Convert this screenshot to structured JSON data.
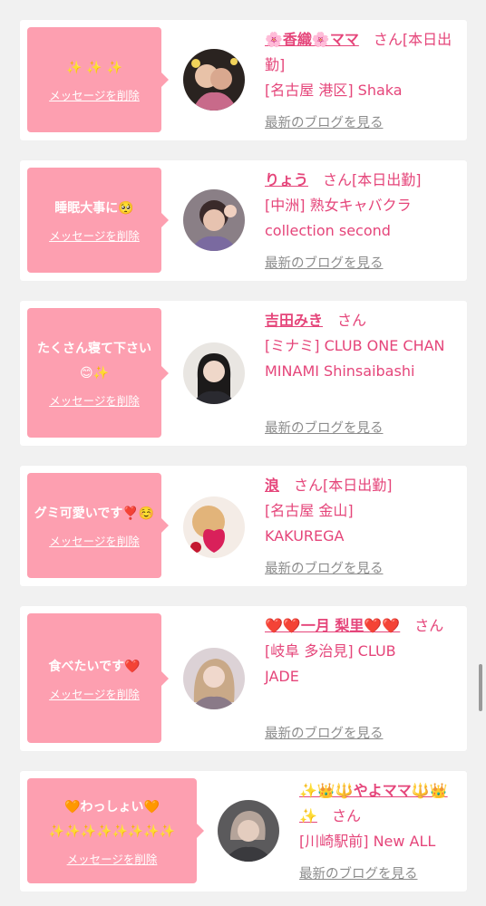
{
  "common": {
    "delete_label": "メッセージを削除",
    "blog_label": "最新のブログを見る",
    "honorific": "さん"
  },
  "colors": {
    "bubble": "#fd9fb0",
    "name": "#e5457a",
    "link_gray": "#8c8c8c"
  },
  "cards": [
    {
      "message": "✨ ✨ ✨",
      "name": "🌸香織🌸ママ",
      "status": "[本日出勤]",
      "shop": "[名古屋 港区] Shaka"
    },
    {
      "message": "睡眠大事に🥺",
      "name": "りょう",
      "status": "[本日出勤]",
      "shop": "[中洲] 熟女キャバクラ collection second"
    },
    {
      "message": "たくさん寝て下さい😊✨",
      "name": "吉田みき",
      "status": "",
      "shop": "[ミナミ] CLUB ONE CHAN MINAMI Shinsaibashi"
    },
    {
      "message": "グミ可愛いです❣️☺️",
      "name": "浪",
      "status": "[本日出勤]",
      "shop": "[名古屋 金山] KAKUREGA"
    },
    {
      "message": "食べたいです❤️",
      "name": "❤️❤️一月 梨里❤️❤️",
      "status": "",
      "shop": "[岐阜 多治見] CLUB JADE"
    },
    {
      "message": "🧡わっしょい🧡 ✨✨✨✨✨✨✨✨",
      "name": "✨👑🔱やよママ🔱👑✨",
      "status": "",
      "shop": "[川崎駅前] New ALL"
    }
  ]
}
